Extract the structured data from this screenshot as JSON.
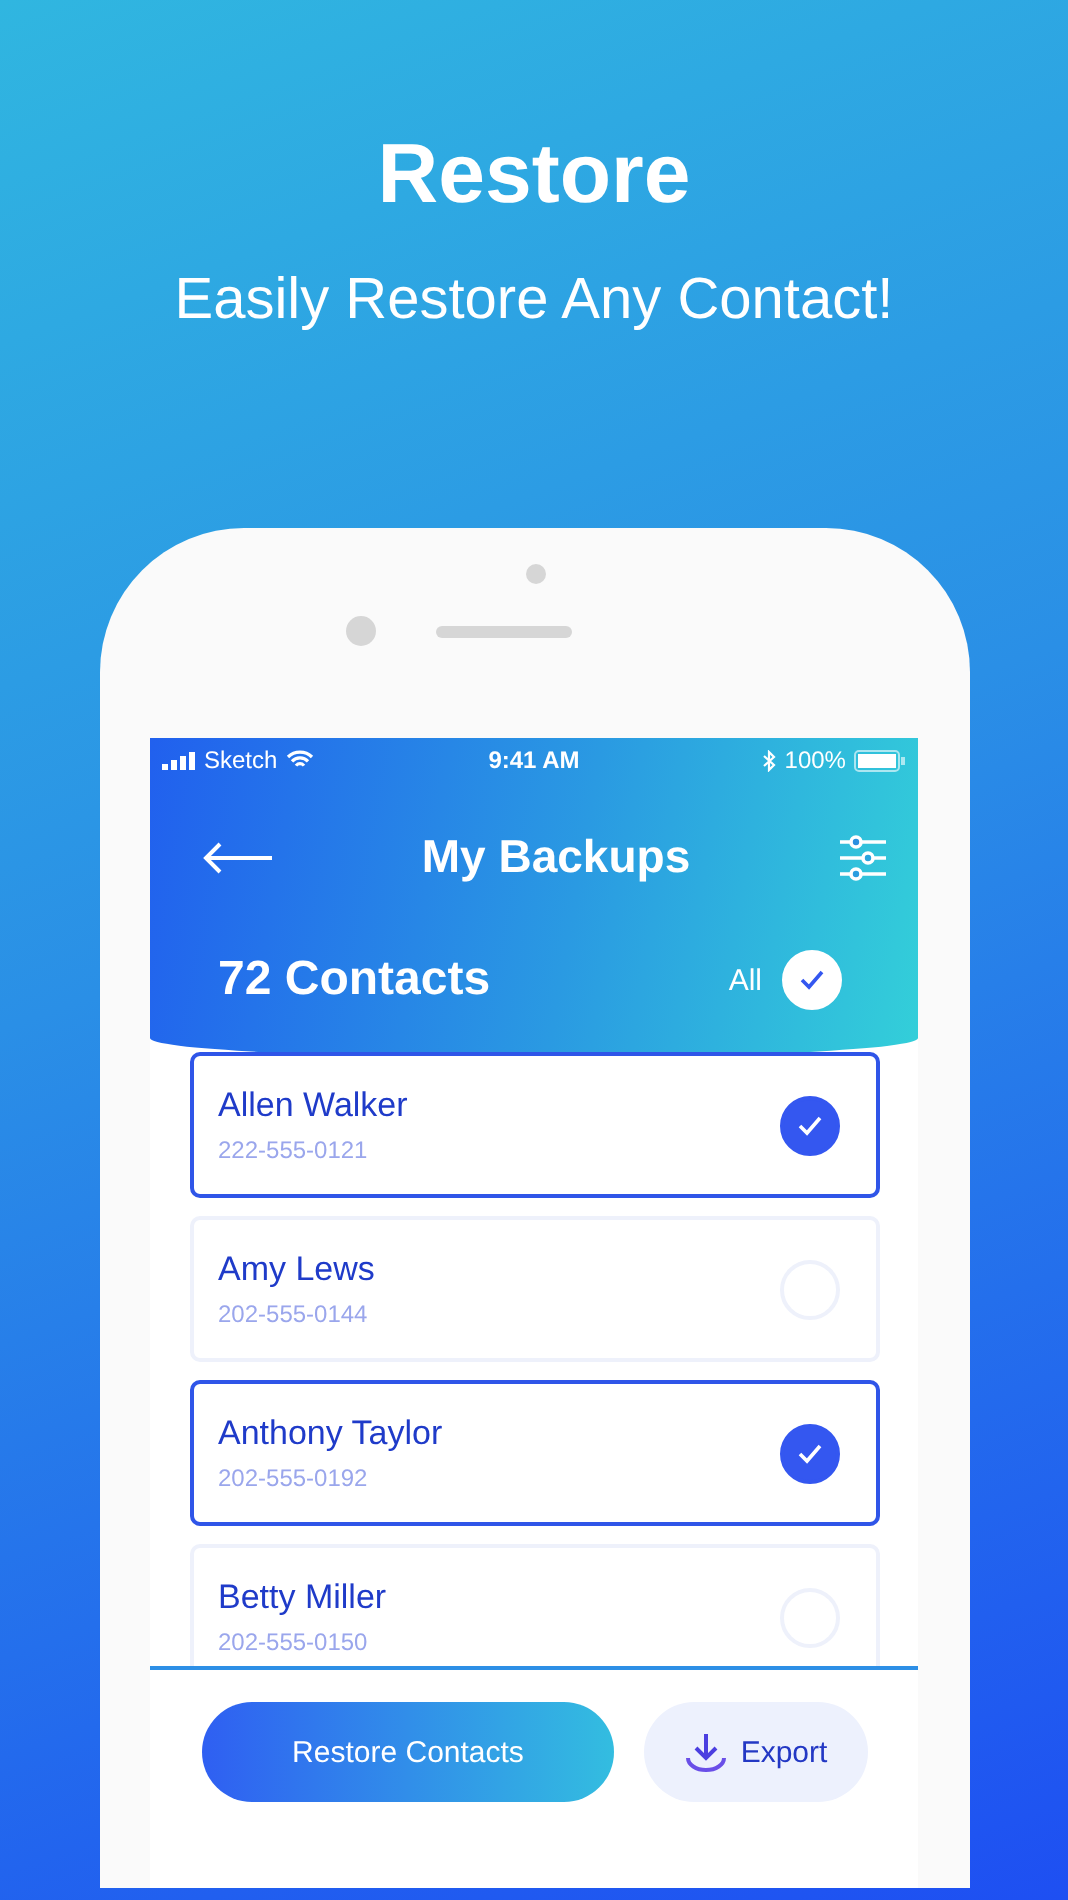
{
  "title": "Restore",
  "subtitle": "Easily Restore Any Contact!",
  "status_bar": {
    "carrier": "Sketch",
    "time": "9:41 AM",
    "battery": "100%"
  },
  "nav": {
    "title": "My Backups"
  },
  "summary": {
    "count": "72 Contacts",
    "all_label": "All",
    "all_checked": true
  },
  "contacts": [
    {
      "name": "Allen Walker",
      "phone": "222-555-0121",
      "selected": true
    },
    {
      "name": "Amy Lews",
      "phone": "202-555-0144",
      "selected": false
    },
    {
      "name": "Anthony Taylor",
      "phone": "202-555-0192",
      "selected": true
    },
    {
      "name": "Betty Miller",
      "phone": "202-555-0150",
      "selected": false
    }
  ],
  "buttons": {
    "restore": "Restore Contacts",
    "export": "Export"
  }
}
